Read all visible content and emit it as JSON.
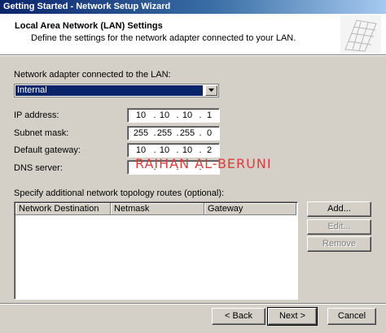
{
  "window": {
    "title": "Getting Started - Network Setup Wizard"
  },
  "header": {
    "title": "Local Area Network (LAN) Settings",
    "subtitle": "Define the settings for the network adapter connected to your LAN."
  },
  "adapter": {
    "label": "Network adapter connected to the LAN:",
    "selected": "Internal"
  },
  "fields": {
    "ip": {
      "label": "IP address:",
      "octets": [
        "10",
        "10",
        "10",
        "1"
      ]
    },
    "subnet": {
      "label": "Subnet mask:",
      "octets": [
        "255",
        "255",
        "255",
        "0"
      ]
    },
    "gateway": {
      "label": "Default gateway:",
      "octets": [
        "10",
        "10",
        "10",
        "2"
      ]
    },
    "dns": {
      "label": "DNS server:",
      "octets": [
        "",
        "",
        "",
        ""
      ]
    }
  },
  "watermark": "RAIHAN AL-BERUNI",
  "routes": {
    "label": "Specify additional network topology routes (optional):",
    "columns": [
      "Network Destination",
      "Netmask",
      "Gateway"
    ],
    "rows": []
  },
  "side_buttons": {
    "add": "Add...",
    "edit": "Edit...",
    "remove": "Remove"
  },
  "nav": {
    "back": "< Back",
    "next": "Next >",
    "cancel": "Cancel"
  }
}
